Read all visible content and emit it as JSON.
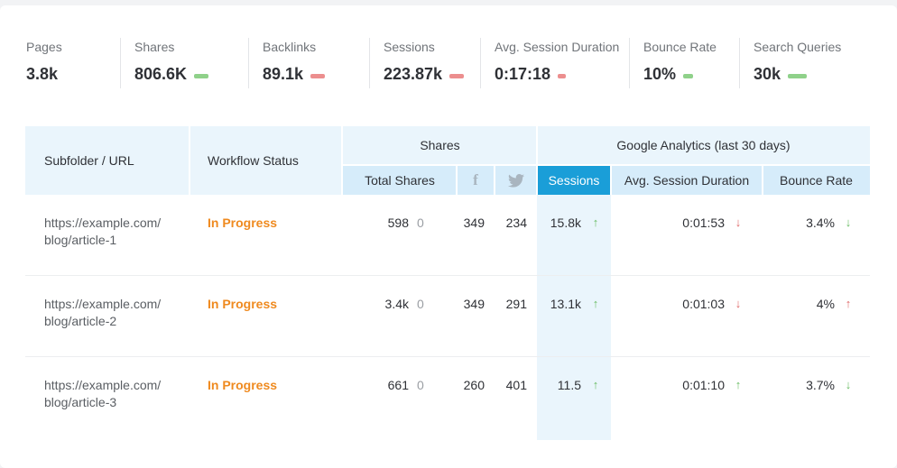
{
  "metrics": [
    {
      "label": "Pages",
      "value": "3.8k",
      "trend": "none"
    },
    {
      "label": "Shares",
      "value": "806.6K",
      "trend": "up"
    },
    {
      "label": "Backlinks",
      "value": "89.1k",
      "trend": "down"
    },
    {
      "label": "Sessions",
      "value": "223.87k",
      "trend": "down"
    },
    {
      "label": "Avg. Session Duration",
      "value": "0:17:18",
      "trend": "down"
    },
    {
      "label": "Bounce Rate",
      "value": "10%",
      "trend": "up"
    },
    {
      "label": "Search Queries",
      "value": "30k",
      "trend": "up"
    }
  ],
  "colors": {
    "trend_up": "#8fd18a",
    "trend_down": "#ec8e8e",
    "active_header": "#1a9ed8",
    "status": "#ef8a1f"
  },
  "table": {
    "headers": {
      "url": "Subfolder / URL",
      "workflow": "Workflow Status",
      "shares_group": "Shares",
      "analytics_group": "Google Analytics (last 30 days)",
      "total_shares": "Total Shares",
      "facebook_icon": "facebook-icon",
      "twitter_icon": "twitter-icon",
      "sessions": "Sessions",
      "avg_duration": "Avg. Session Duration",
      "bounce_rate": "Bounce Rate"
    },
    "rows": [
      {
        "url_line1": "https://example.com/",
        "url_line2": "blog/article-1",
        "status": "In Progress",
        "total_shares": "598",
        "total_shares_delta": "0",
        "facebook": "349",
        "twitter": "234",
        "sessions": "15.8k",
        "sessions_dir": "up",
        "duration": "0:01:53",
        "duration_dir": "down",
        "bounce": "3.4%",
        "bounce_dir": "down"
      },
      {
        "url_line1": "https://example.com/",
        "url_line2": "blog/article-2",
        "status": "In Progress",
        "total_shares": "3.4k",
        "total_shares_delta": "0",
        "facebook": "349",
        "twitter": "291",
        "sessions": "13.1k",
        "sessions_dir": "up",
        "duration": "0:01:03",
        "duration_dir": "down",
        "bounce": "4%",
        "bounce_dir": "up"
      },
      {
        "url_line1": "https://example.com/",
        "url_line2": "blog/article-3",
        "status": "In Progress",
        "total_shares": "661",
        "total_shares_delta": "0",
        "facebook": "260",
        "twitter": "401",
        "sessions": "11.5",
        "sessions_dir": "up",
        "duration": "0:01:10",
        "duration_dir": "up",
        "bounce": "3.7%",
        "bounce_dir": "down"
      }
    ]
  }
}
